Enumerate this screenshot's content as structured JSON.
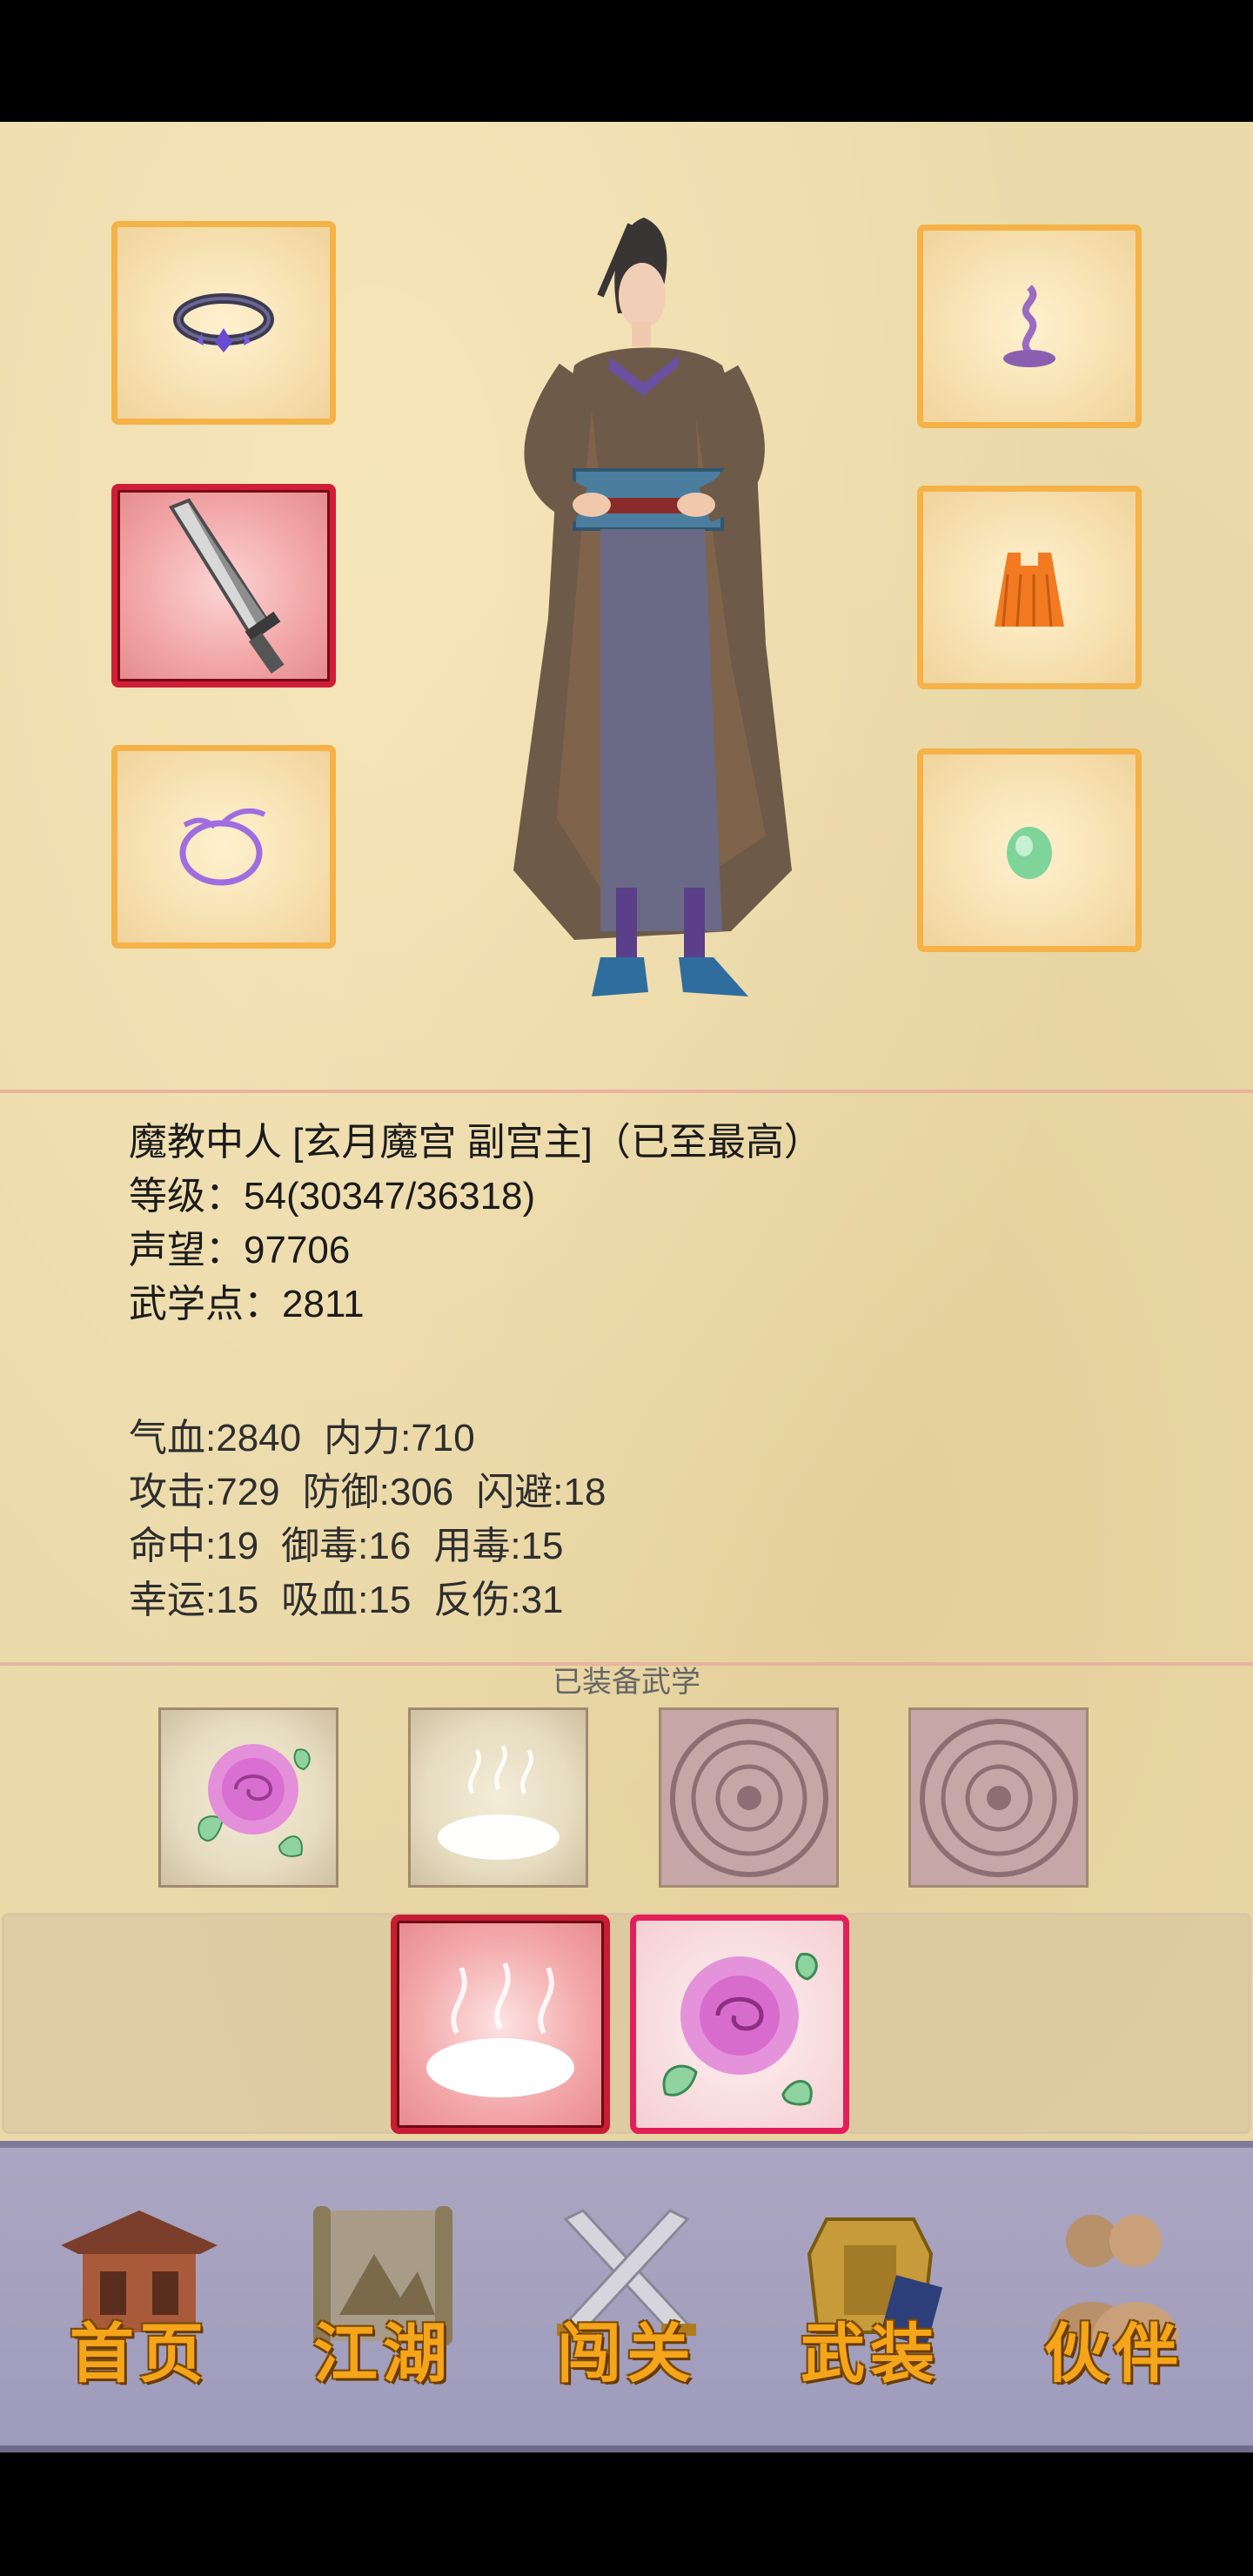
{
  "equipment": {
    "left_slots": [
      "ring-icon",
      "blade-icon",
      "bracelet-icon"
    ],
    "right_slots": [
      "incense-icon",
      "tassel-icon",
      "jade-icon"
    ]
  },
  "profile": {
    "title": "魔教中人 [玄月魔宫 副宫主]（已至最高）",
    "level": "等级：54(30347/36318)",
    "reputation": "声望：97706",
    "martial_points": "武学点：2811"
  },
  "stats": {
    "hp": "气血:2840",
    "mp": "内力:710",
    "attack": "攻击:729",
    "defense": "防御:306",
    "dodge": "闪避:18",
    "hit": "命中:19",
    "poison_resist": "御毒:16",
    "poison_use": "用毒:15",
    "luck": "幸运:15",
    "lifesteal": "吸血:15",
    "reflect": "反伤:31"
  },
  "equipped_skills": {
    "title": "已装备武学",
    "slots": [
      "rose-skill-icon",
      "steam-skill-icon",
      "empty-seal-icon",
      "empty-seal-icon"
    ]
  },
  "skill_tray": [
    "steam-skill-icon",
    "rose-skill-icon"
  ],
  "nav": {
    "home": "首页",
    "jianghu": "江湖",
    "challenge": "闯关",
    "equipment": "武装",
    "partners": "伙伴"
  },
  "colors": {
    "parchment": "#ead9a9",
    "slot_border": "#f4b247",
    "selected_border": "#cf1f36",
    "nav_label": "#f5a51a",
    "nav_bg": "#aaa6c2"
  }
}
